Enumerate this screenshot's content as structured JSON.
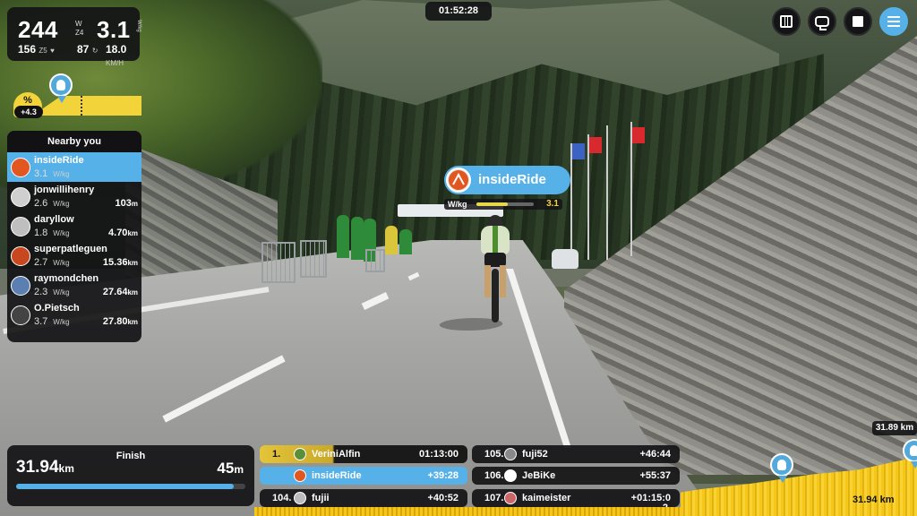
{
  "timer": "01:52:28",
  "stats": {
    "power": "244",
    "power_unit": "W",
    "zone": "Z4",
    "wkg": "3.1",
    "wkg_unit": "W/kg",
    "hr": "156",
    "hr_zone": "Z5",
    "cadence": "87",
    "speed": "18.0",
    "speed_unit": "KM/H"
  },
  "gradient": {
    "label": "%",
    "value": "+4.3"
  },
  "nearby": {
    "title": "Nearby you",
    "wkg_unit": "W/kg",
    "riders": [
      {
        "name": "insideRide",
        "wkg": "3.1",
        "distance": "",
        "unit": ""
      },
      {
        "name": "jonwillihenry",
        "wkg": "2.6",
        "distance": "103",
        "unit": "m"
      },
      {
        "name": "daryllow",
        "wkg": "1.8",
        "distance": "4.70",
        "unit": "km"
      },
      {
        "name": "superpatleguen",
        "wkg": "2.7",
        "distance": "15.36",
        "unit": "km"
      },
      {
        "name": "raymondchen",
        "wkg": "2.3",
        "distance": "27.64",
        "unit": "km"
      },
      {
        "name": "O.Pietsch",
        "wkg": "3.7",
        "distance": "27.80",
        "unit": "km"
      }
    ]
  },
  "nameplate": {
    "name": "insideRide",
    "unit": "W/kg",
    "value": "3.1",
    "power_fill": 0.55
  },
  "finish": {
    "label": "Finish",
    "distance": "31.94",
    "distance_unit": "km",
    "elevation": "45",
    "elevation_unit": "m",
    "progress": 0.95
  },
  "leaderboard": {
    "left": [
      {
        "pos": "1.",
        "name": "VeriniAlfin",
        "gap": "01:13:00"
      },
      {
        "pos": "",
        "name": "insideRide",
        "gap": "+39:28"
      },
      {
        "pos": "104.",
        "name": "fujii",
        "gap": "+40:52"
      }
    ],
    "right": [
      {
        "pos": "105.",
        "name": "fuji52",
        "gap": "+46:44"
      },
      {
        "pos": "106.",
        "name": "JeBiKe",
        "gap": "+55:37"
      },
      {
        "pos": "107.",
        "name": "kaimeister",
        "gap": "+01:15:0"
      }
    ],
    "overflow": "2"
  },
  "profile": {
    "distance": "31.94 km",
    "top_distance": "31.89 km"
  },
  "buttons": {
    "map": "map-icon",
    "camera": "camera-switch-icon",
    "stop": "stop-icon",
    "menu": "menu-icon"
  },
  "colors": {
    "accent": "#56b1e8",
    "gold": "#f2d43a",
    "panel": "#141416"
  }
}
